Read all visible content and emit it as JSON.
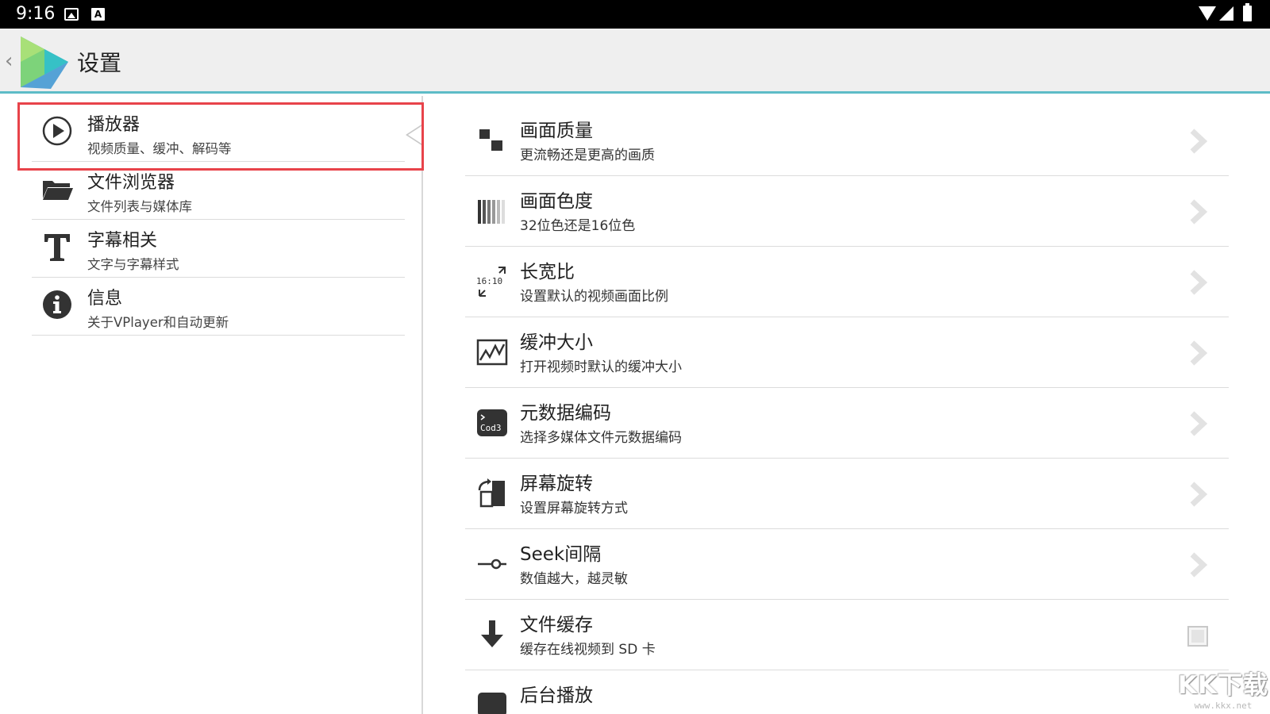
{
  "status_bar": {
    "time": "9:16",
    "notification_icons": [
      "image-icon",
      "keyboard-a-icon"
    ],
    "system_icons": [
      "wifi-icon",
      "cell-signal-icon",
      "battery-icon"
    ]
  },
  "action_bar": {
    "title": "设置",
    "up_icon": "‹",
    "accent_color": "#5dbcc7"
  },
  "left_menu": [
    {
      "icon": "play-circle-icon",
      "title": "播放器",
      "subtitle": "视频质量、缓冲、解码等",
      "selected": true
    },
    {
      "icon": "folder-icon",
      "title": "文件浏览器",
      "subtitle": "文件列表与媒体库",
      "selected": false
    },
    {
      "icon": "text-t-icon",
      "title": "字幕相关",
      "subtitle": "文字与字幕样式",
      "selected": false
    },
    {
      "icon": "info-icon",
      "title": "信息",
      "subtitle": "关于VPlayer和自动更新",
      "selected": false
    }
  ],
  "settings": [
    {
      "icon": "quality-squares-icon",
      "title": "画面质量",
      "subtitle": "更流畅还是更高的画质",
      "control": "chevron"
    },
    {
      "icon": "color-bars-icon",
      "title": "画面色度",
      "subtitle": "32位色还是16位色",
      "control": "chevron"
    },
    {
      "icon": "aspect-ratio-icon",
      "title": "长宽比",
      "subtitle": "设置默认的视频画面比例",
      "control": "chevron",
      "icon_text": "16:10"
    },
    {
      "icon": "buffer-graph-icon",
      "title": "缓冲大小",
      "subtitle": "打开视频时默认的缓冲大小",
      "control": "chevron"
    },
    {
      "icon": "codec-icon",
      "title": "元数据编码",
      "subtitle": "选择多媒体文件元数据编码",
      "control": "chevron",
      "icon_text": "Cod3"
    },
    {
      "icon": "screen-rotate-icon",
      "title": "屏幕旋转",
      "subtitle": "设置屏幕旋转方式",
      "control": "chevron"
    },
    {
      "icon": "seek-slider-icon",
      "title": "Seek间隔",
      "subtitle": "数值越大，越灵敏",
      "control": "chevron"
    },
    {
      "icon": "download-arrow-icon",
      "title": "文件缓存",
      "subtitle": "缓存在线视频到 SD 卡",
      "control": "checkbox",
      "checked": false
    },
    {
      "icon": "background-play-icon",
      "title": "后台播放",
      "subtitle": "",
      "control": "none"
    }
  ],
  "watermark": {
    "logo": "KK下载",
    "url": "www.kkx.net"
  },
  "colors": {
    "highlight_border": "#e8434a",
    "status_bar": "#000000",
    "action_bar": "#efefef"
  }
}
